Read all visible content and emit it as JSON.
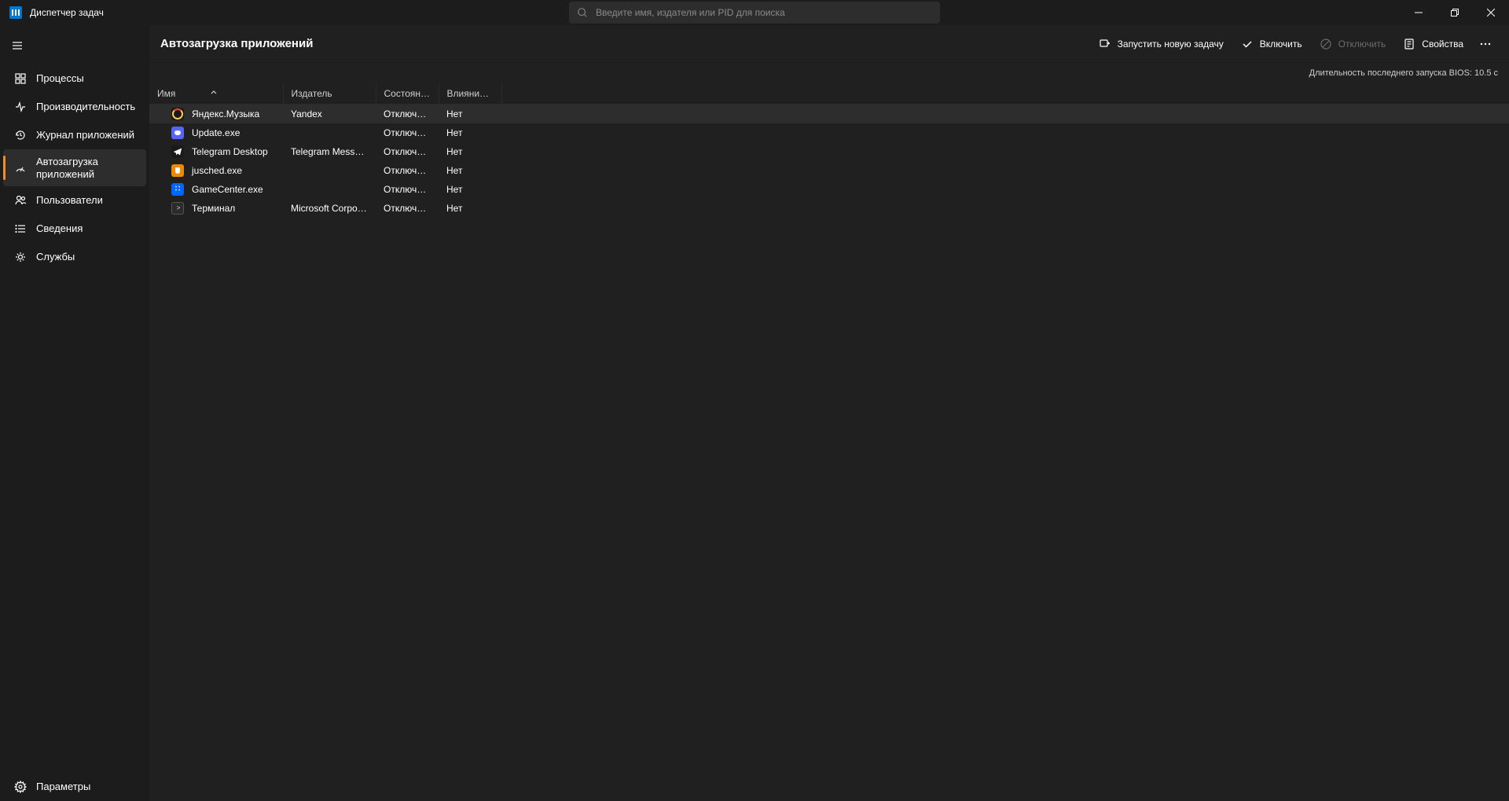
{
  "window": {
    "title": "Диспетчер задач"
  },
  "search": {
    "placeholder": "Введите имя, издателя или PID для поиска"
  },
  "sidebar": {
    "items": [
      {
        "id": "processes",
        "label": "Процессы"
      },
      {
        "id": "performance",
        "label": "Производительность"
      },
      {
        "id": "app-history",
        "label": "Журнал приложений"
      },
      {
        "id": "startup",
        "label": "Автозагрузка приложений"
      },
      {
        "id": "users",
        "label": "Пользователи"
      },
      {
        "id": "details",
        "label": "Сведения"
      },
      {
        "id": "services",
        "label": "Службы"
      }
    ],
    "footer": {
      "label": "Параметры"
    }
  },
  "page": {
    "title": "Автозагрузка приложений",
    "actions": {
      "run_new_task": "Запустить новую задачу",
      "enable": "Включить",
      "disable": "Отключить",
      "properties": "Свойства"
    },
    "status_label": "Длительность последнего запуска BIOS:",
    "status_value": "10.5 с"
  },
  "table": {
    "columns": {
      "name": "Имя",
      "publisher": "Издатель",
      "state": "Состояние",
      "impact": "Влияние на за..."
    },
    "rows": [
      {
        "icon": "yandex",
        "name": "Яндекс.Музыка",
        "publisher": "Yandex",
        "state": "Отключено",
        "impact": "Нет",
        "selected": true
      },
      {
        "icon": "discord",
        "name": "Update.exe",
        "publisher": "",
        "state": "Отключено",
        "impact": "Нет",
        "selected": false
      },
      {
        "icon": "telegram",
        "name": "Telegram Desktop",
        "publisher": "Telegram Messenger LLP",
        "state": "Отключено",
        "impact": "Нет",
        "selected": false
      },
      {
        "icon": "java",
        "name": "jusched.exe",
        "publisher": "",
        "state": "Отключено",
        "impact": "Нет",
        "selected": false
      },
      {
        "icon": "game",
        "name": "GameCenter.exe",
        "publisher": "",
        "state": "Отключено",
        "impact": "Нет",
        "selected": false
      },
      {
        "icon": "term",
        "name": "Терминал",
        "publisher": "Microsoft Corporation",
        "state": "Отключено",
        "impact": "Нет",
        "selected": false
      }
    ]
  }
}
